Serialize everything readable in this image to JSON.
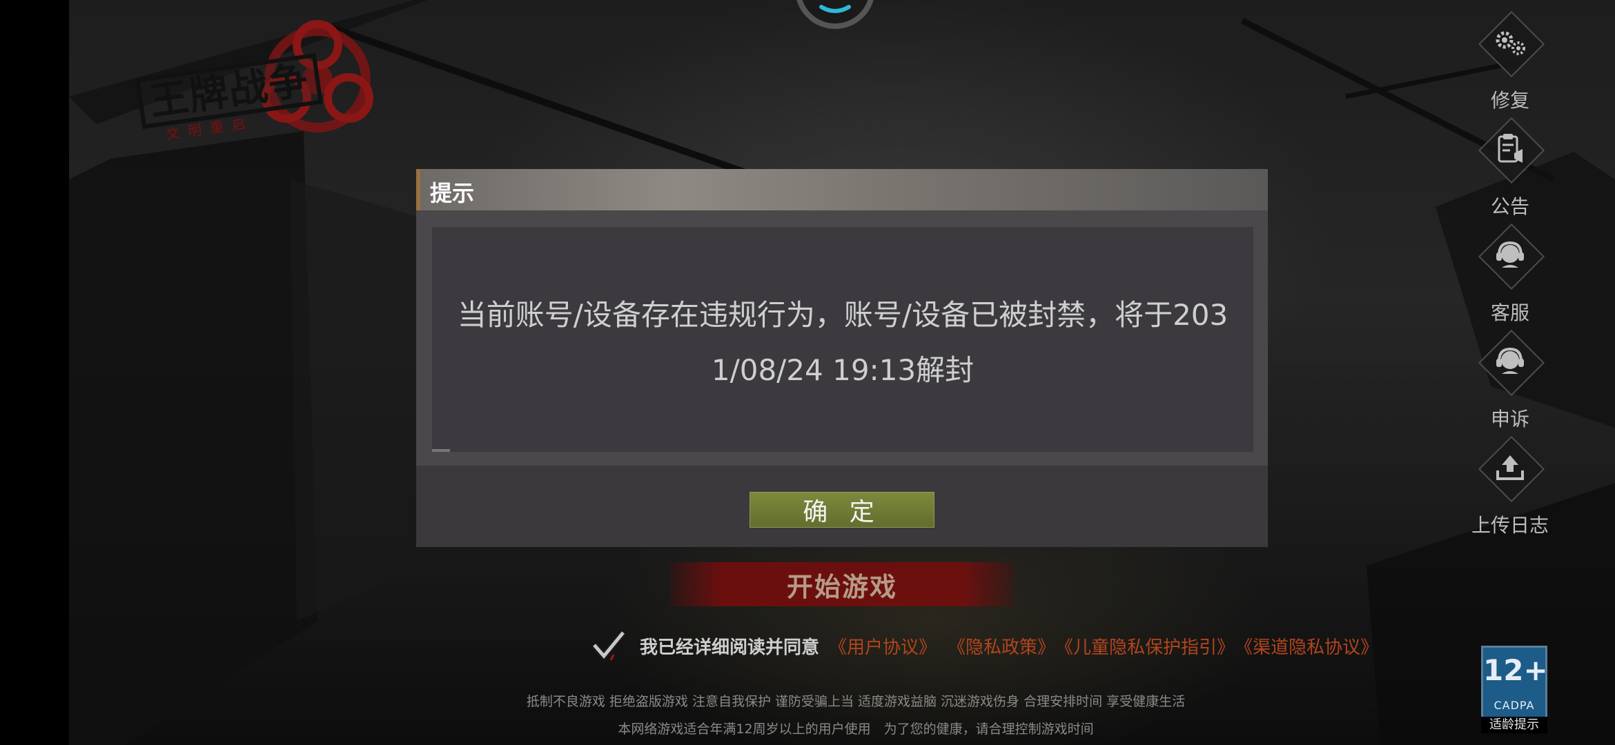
{
  "game": {
    "logo_title": "王牌战争",
    "logo_subtitle": "文明重启"
  },
  "side_menu": [
    {
      "label": "修复",
      "icon": "gear-icon"
    },
    {
      "label": "公告",
      "icon": "notice-icon"
    },
    {
      "label": "客服",
      "icon": "customer-service-icon"
    },
    {
      "label": "申诉",
      "icon": "appeal-icon"
    },
    {
      "label": "上传日志",
      "icon": "upload-icon"
    }
  ],
  "start_button": "开始游戏",
  "agreement": {
    "text": "我已经详细阅读并同意",
    "links": [
      "《用户协议》",
      "《隐私政策》",
      "《儿童隐私保护指引》",
      "《渠道隐私协议》"
    ],
    "checked": true
  },
  "notices": {
    "health": "抵制不良游戏 拒绝盗版游戏 注意自我保护 谨防受骗上当 适度游戏益脑 沉迷游戏伤身 合理安排时间 享受健康生活",
    "age": "本网络游戏适合年满12周岁以上的用户使用　为了您的健康，请合理控制游戏时间"
  },
  "age_badge": {
    "rating": "12+",
    "org": "CADPA",
    "tip": "适龄提示"
  },
  "dialog": {
    "title": "提示",
    "message_line1": "当前账号/设备存在违规行为，账号/设备已被封禁，将于203",
    "message_line2": "1/08/24 19:13解封",
    "confirm": "确 定"
  },
  "colors": {
    "start_red": "#780c0c",
    "link_orange": "#b2451d",
    "confirm_green": "#6f7a33",
    "badge_blue": "#1d5b88"
  }
}
